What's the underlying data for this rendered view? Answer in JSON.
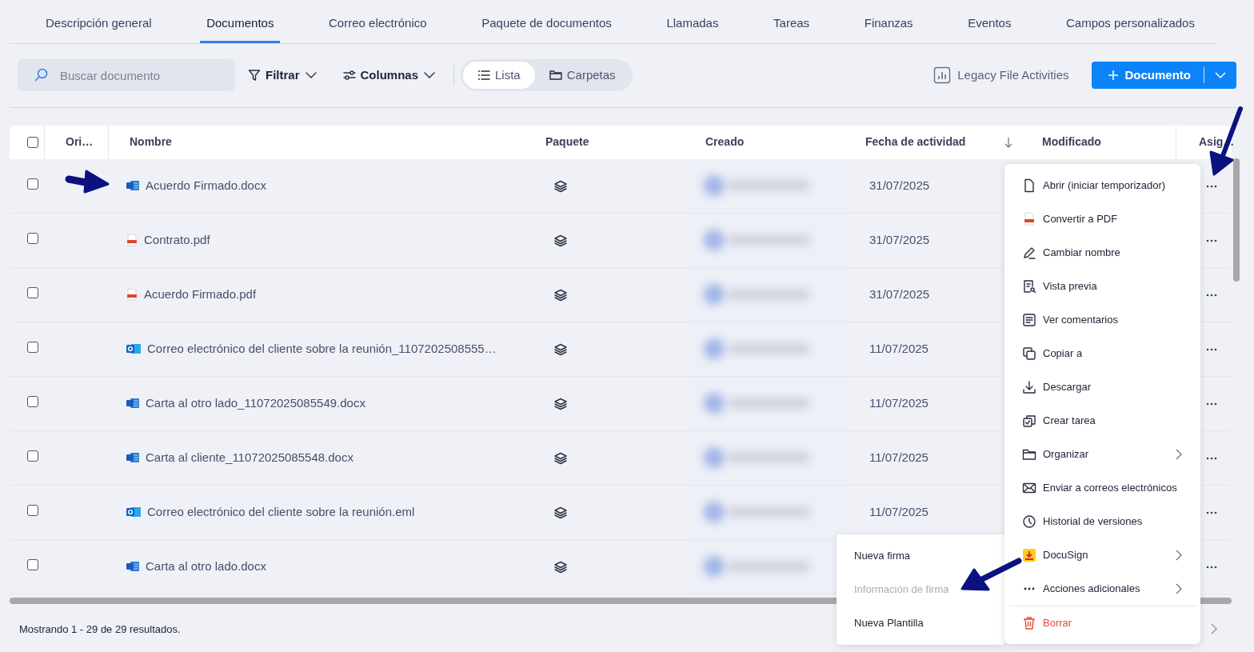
{
  "tabs": [
    {
      "label": "Descripción general",
      "selected": false
    },
    {
      "label": "Documentos",
      "selected": true
    },
    {
      "label": "Correo electrónico",
      "selected": false
    },
    {
      "label": "Paquete de documentos",
      "selected": false
    },
    {
      "label": "Llamadas",
      "selected": false
    },
    {
      "label": "Tareas",
      "selected": false
    },
    {
      "label": "Finanzas",
      "selected": false
    },
    {
      "label": "Eventos",
      "selected": false
    },
    {
      "label": "Campos personalizados",
      "selected": false
    }
  ],
  "toolbar": {
    "search": {
      "placeholder": "Buscar documento"
    },
    "filter": "Filtrar",
    "columns": "Columnas",
    "views": [
      {
        "label": "Lista",
        "selected": true
      },
      {
        "label": "Carpetas",
        "selected": false
      }
    ],
    "legacy": "Legacy File Activities",
    "new_button": "Documento"
  },
  "table": {
    "select_all": {
      "checked": false
    },
    "columns": [
      {
        "label": "Ori…",
        "sorted": false
      },
      {
        "label": "Nombre",
        "sorted": false
      },
      {
        "label": "Paquete",
        "sorted": false
      },
      {
        "label": "Creado",
        "sorted": false
      },
      {
        "label": "Fecha de actividad",
        "sorted": true
      },
      {
        "label": "Modificado",
        "sorted": false
      },
      {
        "label": "Asig…",
        "sorted": false
      }
    ],
    "rows": [
      {
        "name": "Acuerdo Firmado.docx",
        "kind": "word",
        "date": "31/07/2025",
        "checked": false
      },
      {
        "name": "Contrato.pdf",
        "kind": "pdf",
        "date": "31/07/2025",
        "checked": false
      },
      {
        "name": "Acuerdo Firmado.pdf",
        "kind": "pdf",
        "date": "31/07/2025",
        "checked": false
      },
      {
        "name": "Correo electrónico del cliente sobre la reunión_1107202508555…",
        "kind": "outlook",
        "date": "11/07/2025",
        "checked": false
      },
      {
        "name": "Carta al otro lado_11072025085549.docx",
        "kind": "word",
        "date": "11/07/2025",
        "checked": false
      },
      {
        "name": "Carta al cliente_11072025085548.docx",
        "kind": "word",
        "date": "11/07/2025",
        "checked": false
      },
      {
        "name": "Correo electrónico del cliente sobre la reunión.eml",
        "kind": "outlook",
        "date": "11/07/2025",
        "checked": false
      },
      {
        "name": "Carta al otro lado.docx",
        "kind": "word",
        "checked": false
      }
    ]
  },
  "context_menu": {
    "items": [
      {
        "label": "Abrir (iniciar temporizador)",
        "kind": "action",
        "submenu": false
      },
      {
        "label": "Convertir a PDF",
        "kind": "action",
        "submenu": false
      },
      {
        "label": "Cambiar nombre",
        "kind": "action",
        "submenu": false
      },
      {
        "label": "Vista previa",
        "kind": "action",
        "submenu": false
      },
      {
        "label": "Ver comentarios",
        "kind": "action",
        "submenu": false
      },
      {
        "label": "Copiar a",
        "kind": "action",
        "submenu": false
      },
      {
        "label": "Descargar",
        "kind": "action",
        "submenu": false
      },
      {
        "label": "Crear tarea",
        "kind": "action",
        "submenu": false
      },
      {
        "label": "Organizar",
        "kind": "action",
        "submenu": true
      },
      {
        "label": "Enviar a correos electrónicos",
        "kind": "action",
        "submenu": false
      },
      {
        "label": "Historial de versiones",
        "kind": "action",
        "submenu": false
      },
      {
        "label": "DocuSign",
        "kind": "action",
        "submenu": true
      },
      {
        "label": "Acciones adicionales",
        "kind": "action",
        "submenu": true
      },
      {
        "label": "Borrar",
        "kind": "danger",
        "submenu": false
      }
    ]
  },
  "submenu": {
    "items": [
      {
        "label": "Nueva firma",
        "disabled": false
      },
      {
        "label": "Información de firma",
        "disabled": true
      },
      {
        "label": "Nueva Plantilla",
        "disabled": false
      }
    ]
  },
  "footer": {
    "summary": "Mostrando 1 - 29 de 29 resultados."
  }
}
